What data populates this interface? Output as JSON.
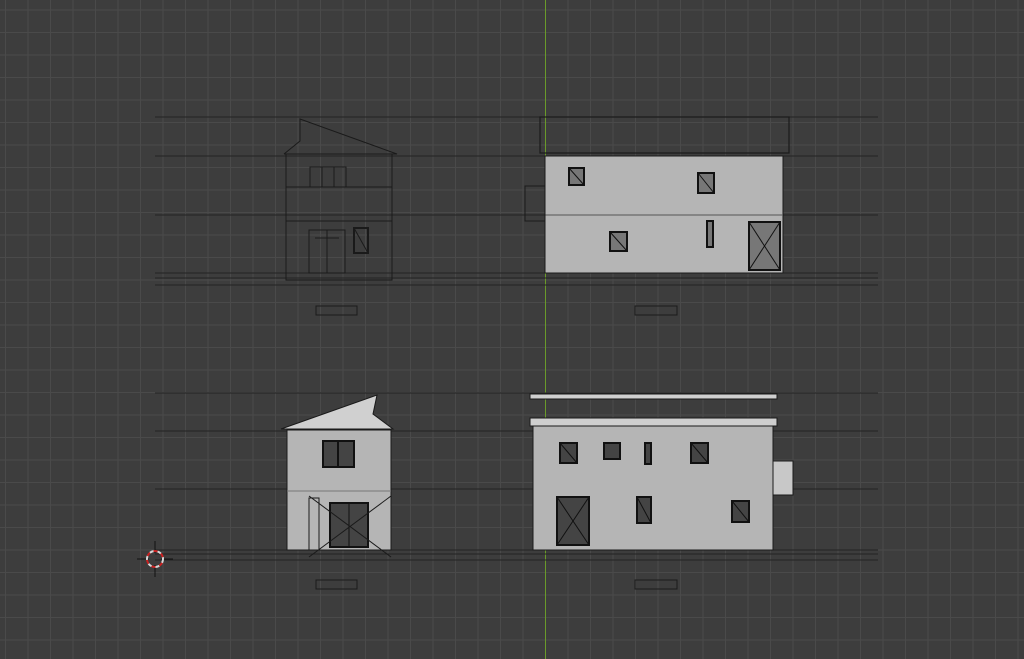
{
  "viewport": {
    "name": "3d-viewport-orthographic",
    "background": "#3d3d3d",
    "grid_color": "#4a4a4a",
    "y_axis_color": "#6a9a2a",
    "cursor_colors": [
      "#d8d8d8",
      "#cc2222"
    ]
  },
  "elevations": {
    "wall_color": "#b5b5b5",
    "line_color": "#1a1a1a",
    "guide_line_color": "#222222",
    "window_fill": "#333333"
  }
}
